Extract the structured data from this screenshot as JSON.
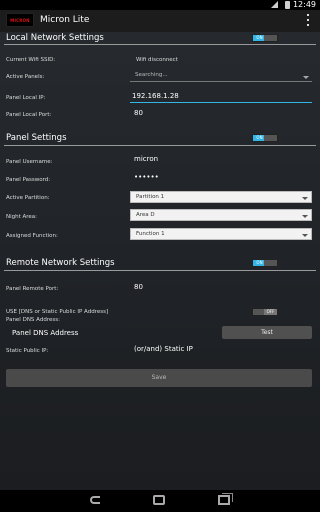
{
  "status_bar": {
    "time": "12:49"
  },
  "action_bar": {
    "title": "Micron Lite",
    "logo_text": "MICRON",
    "brand_color": "#d11a1a"
  },
  "local": {
    "title": "Local Network Settings",
    "toggle": "ON",
    "ssid_label": "Current Wifi SSID:",
    "ssid_value": "Wifi disconnect",
    "panels_label": "Active Panels:",
    "panels_value": "Searching...",
    "ip_label": "Panel Local IP:",
    "ip_value": "192.168.1.28",
    "port_label": "Panel Local Port:",
    "port_value": "80"
  },
  "panel": {
    "title": "Panel Settings",
    "toggle": "ON",
    "username_label": "Panel Username:",
    "username_value": "micron",
    "password_label": "Panel Password:",
    "password_value": "••••••",
    "partition_label": "Active Partition:",
    "partition_value": "Partition 1",
    "night_label": "Night Area:",
    "night_value": "Area D",
    "function_label": "Assigned Function:",
    "function_value": "Function 1"
  },
  "remote": {
    "title": "Remote Network Settings",
    "toggle": "ON",
    "port_label": "Panel Remote Port:",
    "port_value": "80",
    "use_label": "USE [DNS or Static Public IP Address]",
    "use_toggle": "OFF",
    "dns_label": "Panel DNS Address:",
    "dns_address_label": "Panel DNS Address",
    "test_label": "Test",
    "static_ip_label": "Static Public IP:",
    "static_ip_value": "(or/and) Static IP"
  },
  "save_label": "Save",
  "accent": "#33b5e5"
}
